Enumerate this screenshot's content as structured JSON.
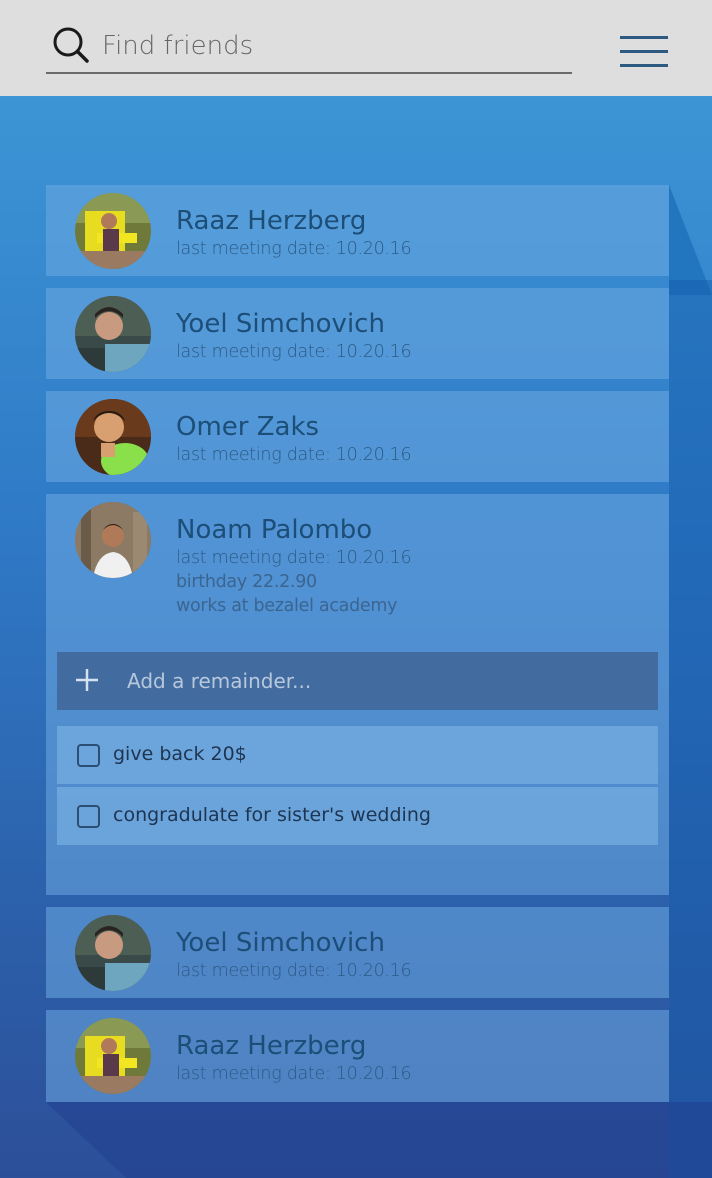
{
  "search": {
    "placeholder": "Find friends"
  },
  "menu": {
    "icon": "hamburger-menu-icon"
  },
  "friends": [
    {
      "name": "Raaz Herzberg",
      "last_meeting": "last meeting date: 10.20.16"
    },
    {
      "name": "Yoel Simchovich",
      "last_meeting": "last meeting date: 10.20.16"
    },
    {
      "name": "Omer Zaks",
      "last_meeting": "last meeting date: 10.20.16"
    },
    {
      "name": "Noam Palombo",
      "last_meeting": "last meeting date: 10.20.16",
      "birthday": "birthday 22.2.90",
      "work": "works at bezalel academy",
      "remainder_placeholder": "Add a remainder...",
      "todos": [
        {
          "text": "give back 20$",
          "checked": false
        },
        {
          "text": "congradulate for sister's wedding",
          "checked": false
        }
      ]
    },
    {
      "name": "Yoel Simchovich",
      "last_meeting": "last meeting date: 10.20.16"
    },
    {
      "name": "Raaz Herzberg",
      "last_meeting": "last meeting date: 10.20.16"
    }
  ],
  "colors": {
    "topbar": "#dedede",
    "accent": "#1c4e78",
    "remainder_bar": "#426ba0"
  }
}
